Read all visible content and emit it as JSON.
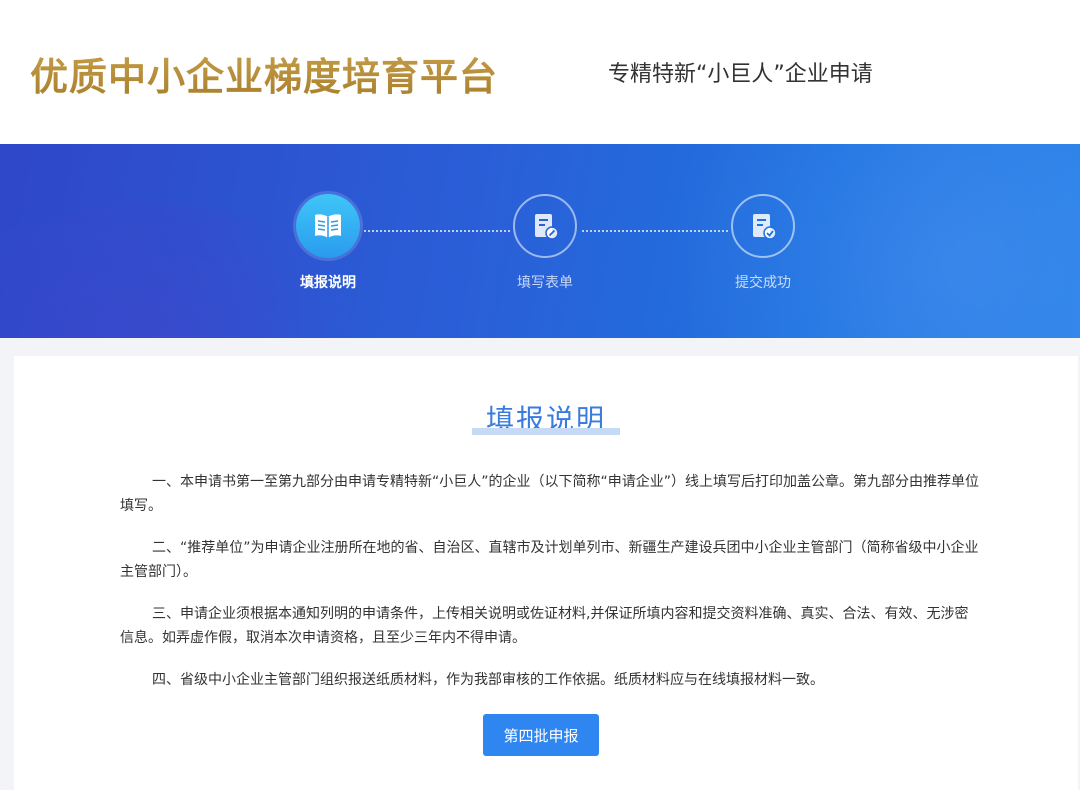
{
  "header": {
    "brand": "优质中小企业梯度培育平台",
    "subtitle": "专精特新“小巨人”企业申请"
  },
  "steps": [
    {
      "label": "填报说明",
      "icon": "book-icon",
      "state": "active"
    },
    {
      "label": "填写表单",
      "icon": "form-edit-icon",
      "state": "inactive"
    },
    {
      "label": "提交成功",
      "icon": "document-check-icon",
      "state": "inactive"
    }
  ],
  "content": {
    "title": "填报说明",
    "paragraphs": [
      "一、本申请书第一至第九部分由申请专精特新“小巨人”的企业（以下简称“申请企业”）线上填写后打印加盖公章。第九部分由推荐单位填写。",
      "二、“推荐单位”为申请企业注册所在地的省、自治区、直辖市及计划单列市、新疆生产建设兵团中小企业主管部门（简称省级中小企业主管部门）。",
      "三、申请企业须根据本通知列明的申请条件，上传相关说明或佐证材料,并保证所填内容和提交资料准确、真实、合法、有效、无涉密信息。如弄虚作假，取消本次申请资格，且至少三年内不得申请。",
      "四、省级中小企业主管部门组织报送纸质材料，作为我部审核的工作依据。纸质材料应与在线填报材料一致。"
    ],
    "submit_label": "第四批申报"
  },
  "colors": {
    "brand_gold": "#b08a32",
    "accent_blue": "#2f86f0",
    "title_blue": "#3a7be0",
    "banner_start": "#2f47c9",
    "banner_end": "#2a82e8"
  }
}
